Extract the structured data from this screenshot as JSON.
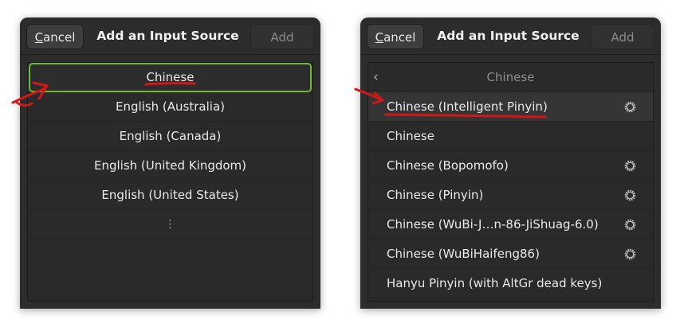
{
  "left_dialog": {
    "cancel_label": "Cancel",
    "title": "Add an Input Source",
    "add_label": "Add",
    "languages": [
      "Chinese",
      "English (Australia)",
      "English (Canada)",
      "English (United Kingdom)",
      "English (United States)"
    ],
    "more_glyph": "⋮"
  },
  "right_dialog": {
    "cancel_label": "Cancel",
    "title": "Add an Input Source",
    "add_label": "Add",
    "back_label": "Chinese",
    "back_glyph": "‹",
    "sources": [
      "Chinese (Intelligent Pinyin)",
      "Chinese",
      "Chinese (Bopomofo)",
      "Chinese (Pinyin)",
      "Chinese (WuBi-J…n-86-JiShuag-6.0)",
      "Chinese (WuBiHaifeng86)",
      "Hanyu Pinyin (with AltGr dead keys)"
    ]
  },
  "icons": {
    "settings": "gear-icon",
    "back": "chevron-left-icon"
  },
  "colors": {
    "focus_border": "#6fb83a",
    "annotation_red": "#d41616",
    "dialog_bg": "#2c2c2c"
  }
}
